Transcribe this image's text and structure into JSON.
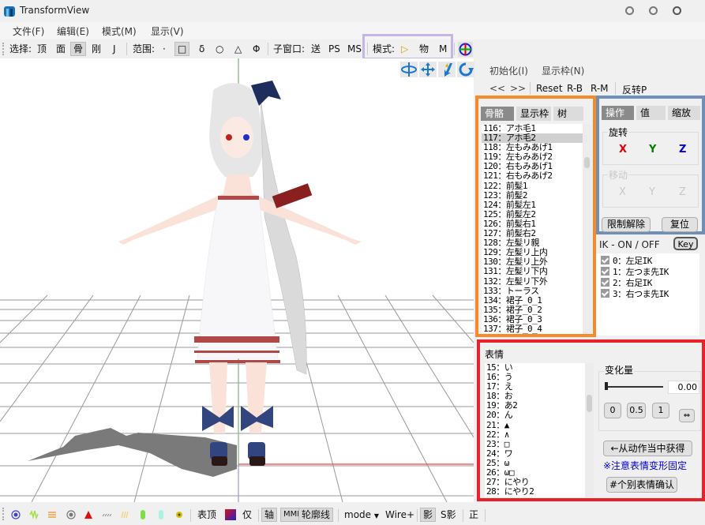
{
  "window": {
    "title": "TransformView",
    "controls": [
      "minimize",
      "maximize",
      "close"
    ]
  },
  "menu": {
    "items": [
      "文件(F)",
      "编辑(E)",
      "模式(M)",
      "显示(V)"
    ]
  },
  "toolbar": {
    "select_label": "选择:",
    "select_items": [
      "顶",
      "面",
      "骨",
      "刚",
      "J"
    ],
    "select_active": "骨",
    "range_label": "范围:",
    "range_items": [
      "·",
      "□",
      "δ",
      "○",
      "△",
      "Φ"
    ],
    "range_active": "□",
    "subwindow_label": "子窗口:",
    "subwindow_items": [
      "送",
      "PS",
      "MS"
    ],
    "mode_label": "模式:",
    "mode_items": [
      "▷",
      "物",
      "M"
    ],
    "mode_active_color": "#f3e08a"
  },
  "gizmo": {
    "icons": [
      "rotate-axes-icon",
      "move-arrows-icon",
      "local-move-icon",
      "rotate-icon",
      "world-axis-icon"
    ]
  },
  "right_top": {
    "menu": [
      "初始化(I)",
      "显示枠(N)"
    ],
    "buttons": [
      "<<",
      ">>",
      "Reset",
      "R-B",
      "R-M",
      "反转P"
    ]
  },
  "bone_panel": {
    "tabs": [
      "骨骼",
      "显示枠",
      "树"
    ],
    "active_tab": "骨骼",
    "items": [
      "116：アホ毛1",
      "117：アホ毛2",
      "118：左もみあげ1",
      "119：左もみあげ2",
      "120：右もみあげ1",
      "121：右もみあげ2",
      "122：前髪1",
      "123：前髪2",
      "124：前髪左1",
      "125：前髪左2",
      "126：前髪右1",
      "127：前髪右2",
      "128：左髪リ親",
      "129：左髪リ上内",
      "130：左髪リ上外",
      "131：左髪リ下内",
      "132：左髪リ下外",
      "133：トーラス",
      "134：裙子_0_1",
      "135：裙子_0_2",
      "136：裙子_0_3",
      "137：裙子_0_4"
    ],
    "selected_index": 1
  },
  "op_panel": {
    "tabs": [
      "操作",
      "值",
      "缩放"
    ],
    "active_tab": "操作",
    "rotate_label": "旋转",
    "move_label": "移动",
    "axes": [
      "X",
      "Y",
      "Z"
    ],
    "axis_colors": [
      "#e00000",
      "#008000",
      "#0000e0"
    ],
    "disabled_color": "#c8c8c8",
    "unlock_button": "限制解除",
    "reset_button": "复位"
  },
  "ik_panel": {
    "header": "IK - ON / OFF",
    "key_button": "Key",
    "items": [
      {
        "label": "0：左足IK",
        "checked": true
      },
      {
        "label": "1：左つま先IK",
        "checked": true
      },
      {
        "label": "2：右足IK",
        "checked": true
      },
      {
        "label": "3：右つま先IK",
        "checked": true
      }
    ]
  },
  "morph_panel": {
    "title": "表情",
    "items": [
      "15：い",
      "16：う",
      "17：え",
      "18：お",
      "19：あ2",
      "20：ん",
      "21：▲",
      "22：∧",
      "23：□",
      "24：ワ",
      "25：ω",
      "26：ω□",
      "27：にやり",
      "28：にやり2"
    ],
    "amount_label": "变化量",
    "amount_value": "0.00",
    "slider_fraction": 0.0,
    "preset_buttons": [
      "0",
      "0.5",
      "1"
    ],
    "swap_button": "⇔",
    "get_from_motion_button": "←从动作当中获得",
    "notice": "※注意表情变形固定",
    "notice_color": "#0000d0",
    "confirm_button": "#个别表情确认"
  },
  "bottombar": {
    "icons": [
      "select-point-icon",
      "green-particles-icon",
      "orange-particles-icon",
      "gray-point-icon",
      "red-triangle-icon",
      "gray-lines-icon",
      "yellow-lines-icon",
      "green-capsule-icon",
      "cyan-capsule-icon",
      "yellow-gear-icon"
    ],
    "labels": [
      "表顶",
      "仅"
    ],
    "toggles": [
      "轴",
      "MMD",
      "轮廓线"
    ],
    "mode_dropdown": "mode",
    "wire_label": "Wire+",
    "shadow_toggles": [
      "影",
      "S影"
    ],
    "last_label": "正"
  }
}
